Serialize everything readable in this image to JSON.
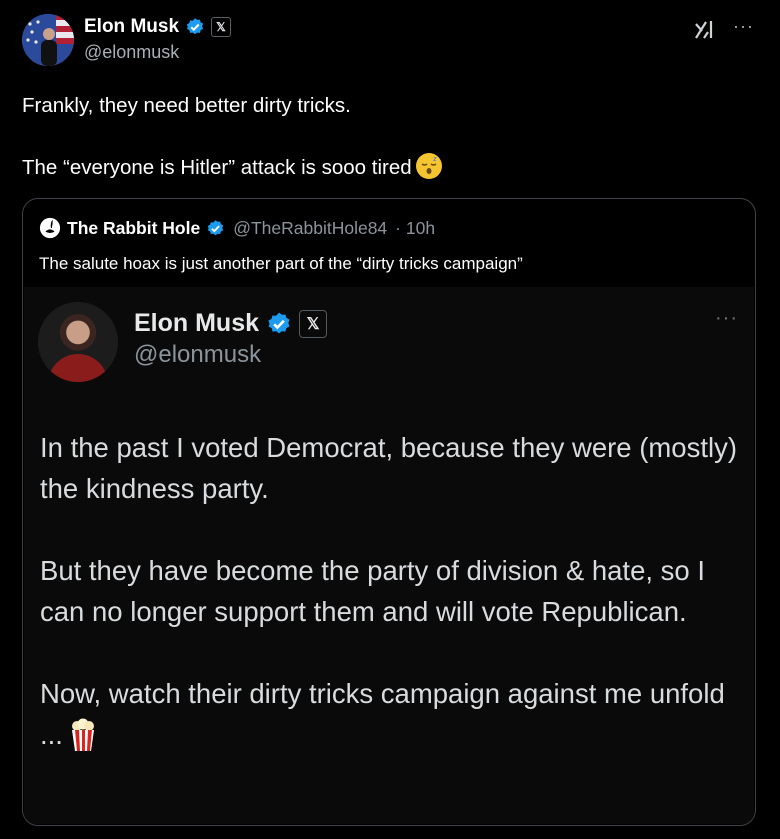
{
  "tweet": {
    "author_name": "Elon Musk",
    "author_handle": "@elonmusk",
    "x_badge": "𝕏",
    "more": "···",
    "text_line1": "Frankly, they need better dirty tricks.",
    "text_line2": "The “everyone is Hitler” attack is sooo tired"
  },
  "quote": {
    "author_name": "The Rabbit Hole",
    "author_handle": "@TheRabbitHole84",
    "time": "· 10h",
    "text": "The salute hoax is just another part of the “dirty tricks campaign”"
  },
  "embedded": {
    "author_name": "Elon Musk",
    "author_handle": "@elonmusk",
    "x_badge": "𝕏",
    "more": "···",
    "para1": "In the past I voted Democrat, because they were (mostly) the kindness party.",
    "para2": "But they have become the party of division & hate, so I can no longer support them and will vote Republican.",
    "para3": "Now, watch their dirty tricks campaign against me unfold ..."
  },
  "colors": {
    "background": "#000000",
    "verified": "#1d9bf0",
    "secondary_text": "#a9b0b5",
    "border": "#3e4348"
  },
  "icons": [
    "verified-icon",
    "x-badge-icon",
    "grok-icon",
    "more-icon",
    "rabbit-icon",
    "sleeping-emoji-icon",
    "popcorn-emoji-icon"
  ]
}
